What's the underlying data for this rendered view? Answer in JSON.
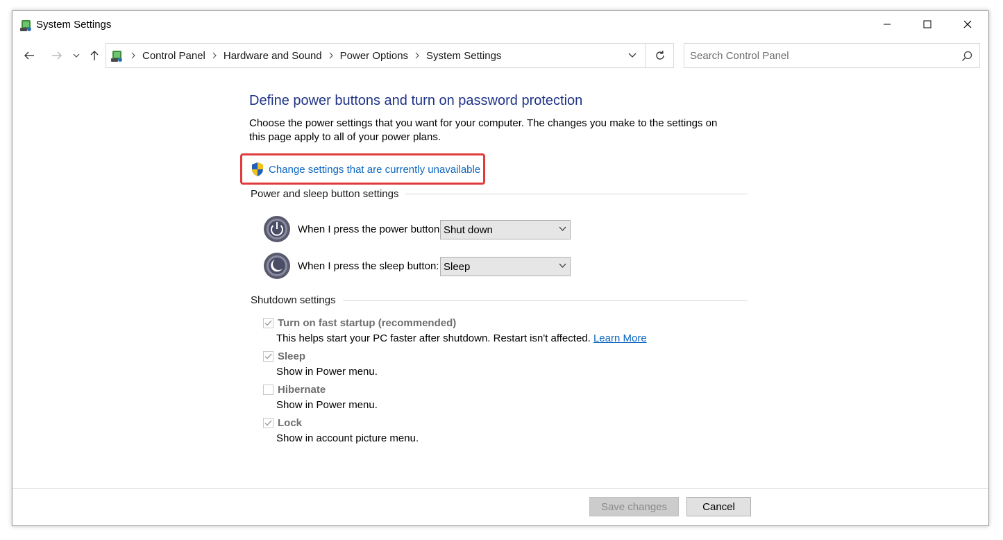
{
  "window": {
    "title": "System Settings"
  },
  "titlebar_buttons": {
    "minimize": "minimize-icon",
    "maximize": "maximize-icon",
    "close": "close-icon"
  },
  "breadcrumb": [
    "Control Panel",
    "Hardware and Sound",
    "Power Options",
    "System Settings"
  ],
  "search": {
    "placeholder": "Search Control Panel"
  },
  "page": {
    "heading": "Define power buttons and turn on password protection",
    "description": "Choose the power settings that you want for your computer. The changes you make to the settings on this page apply to all of your power plans.",
    "change_link": "Change settings that are currently unavailable"
  },
  "power_section": {
    "title": "Power and sleep button settings",
    "power_button_label": "When I press the power button:",
    "power_button_value": "Shut down",
    "sleep_button_label": "When I press the sleep button:",
    "sleep_button_value": "Sleep"
  },
  "shutdown_section": {
    "title": "Shutdown settings",
    "items": [
      {
        "label": "Turn on fast startup (recommended)",
        "desc": "This helps start your PC faster after shutdown. Restart isn't affected.",
        "link": "Learn More",
        "checked": true
      },
      {
        "label": "Sleep",
        "desc": "Show in Power menu.",
        "checked": true
      },
      {
        "label": "Hibernate",
        "desc": "Show in Power menu.",
        "checked": false
      },
      {
        "label": "Lock",
        "desc": "Show in account picture menu.",
        "checked": true
      }
    ]
  },
  "footer": {
    "save_label": "Save changes",
    "cancel_label": "Cancel"
  },
  "colors": {
    "heading": "#1e3287",
    "link": "#0b66c0",
    "highlight_box": "#e03a3a"
  }
}
